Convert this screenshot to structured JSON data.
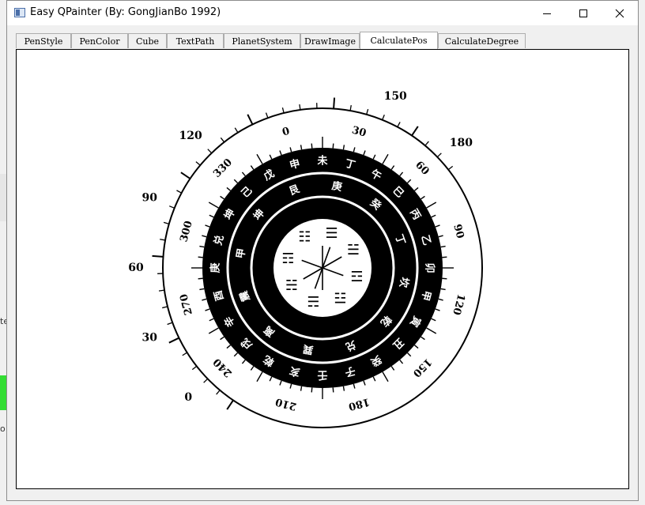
{
  "window": {
    "title": "Easy QPainter (By: GongJianBo 1992)"
  },
  "window_controls": [
    "minimize-icon",
    "maximize-icon",
    "close-icon"
  ],
  "background": {
    "left_fragment_text": "te",
    "left_fragment_text2": "o"
  },
  "tabs": [
    {
      "label": "PenStyle",
      "active": false
    },
    {
      "label": "PenColor",
      "active": false
    },
    {
      "label": "Cube",
      "active": false
    },
    {
      "label": "TextPath",
      "active": false
    },
    {
      "label": "PlanetSystem",
      "active": false
    },
    {
      "label": "DrawImage",
      "active": false
    },
    {
      "label": "CalculatePos",
      "active": true
    },
    {
      "label": "CalculateDegree",
      "active": false
    }
  ],
  "dial": {
    "outer_labels": [
      "0",
      "30",
      "60",
      "90",
      "120",
      "150",
      "180"
    ],
    "ring1_labels": [
      "0",
      "30",
      "60",
      "90",
      "120",
      "150",
      "180",
      "210",
      "240",
      "270",
      "300",
      "330"
    ],
    "ring2_labels": [
      "申",
      "未",
      "丁",
      "午",
      "巳",
      "丙",
      "乙",
      "卯",
      "甲",
      "寅",
      "丑",
      "癸",
      "子",
      "壬",
      "亥",
      "乾",
      "戌",
      "辛",
      "酉",
      "庚",
      "兑",
      "坤",
      "己",
      "戊"
    ],
    "ring3_labels": [
      "庚",
      "癸",
      "丁",
      "坎",
      "乾",
      "兑",
      "巽",
      "离",
      "震",
      "甲",
      "坤",
      "艮"
    ],
    "inner_trigrams": [
      "☰",
      "☱",
      "☲",
      "☳",
      "☴",
      "☵",
      "☶",
      "☷"
    ],
    "colors": {
      "ring_fill": "#000000",
      "ring_text": "#ffffff",
      "line": "#000000"
    }
  }
}
